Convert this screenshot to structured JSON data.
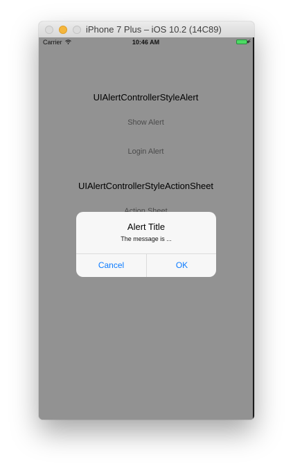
{
  "window": {
    "title": "iPhone 7 Plus – iOS 10.2 (14C89)"
  },
  "statusbar": {
    "carrier": "Carrier",
    "wifi_icon": "wifi-icon",
    "time": "10:46 AM",
    "battery_icon": "battery-icon",
    "charge_icon": "charging-bolt-icon"
  },
  "app": {
    "alert_section_title": "UIAlertControllerStyleAlert",
    "show_alert_label": "Show Alert",
    "login_alert_label": "Login Alert",
    "action_sheet_section_title": "UIAlertControllerStyleActionSheet",
    "action_sheet_label": "Action Sheet"
  },
  "alert": {
    "title": "Alert Title",
    "message": "The message is ...",
    "cancel_label": "Cancel",
    "ok_label": "OK"
  },
  "colors": {
    "dimmed_background": "#929292",
    "alert_action_tint": "#0a7aff",
    "battery": "#4cd964"
  }
}
